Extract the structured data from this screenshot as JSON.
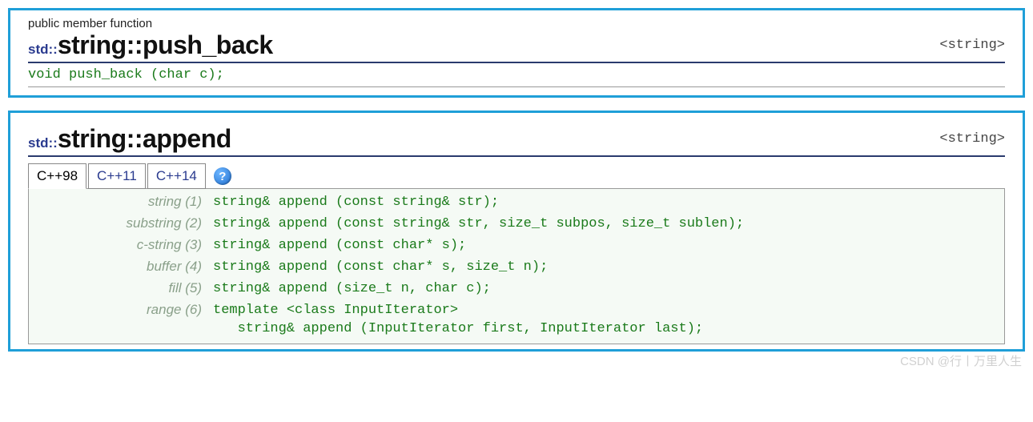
{
  "panel1": {
    "subtype": "public member function",
    "namespace": "std::",
    "title": "string::push_back",
    "header": "<string>",
    "declaration": "void push_back (char c);"
  },
  "panel2": {
    "namespace": "std::",
    "title": "string::append",
    "header": "<string>",
    "tabs": [
      "C++98",
      "C++11",
      "C++14"
    ],
    "activeTab": 0,
    "help": "?",
    "overloads": [
      {
        "label": "string (1)",
        "sig": "string& append (const string& str);"
      },
      {
        "label": "substring (2)",
        "sig": "string& append (const string& str, size_t subpos, size_t sublen);"
      },
      {
        "label": "c-string (3)",
        "sig": "string& append (const char* s);"
      },
      {
        "label": "buffer (4)",
        "sig": "string& append (const char* s, size_t n);"
      },
      {
        "label": "fill (5)",
        "sig": "string& append (size_t n, char c);"
      },
      {
        "label": "range (6)",
        "sig": "template <class InputIterator>\n   string& append (InputIterator first, InputIterator last);"
      }
    ]
  },
  "watermark": "CSDN @行丨万里人生"
}
